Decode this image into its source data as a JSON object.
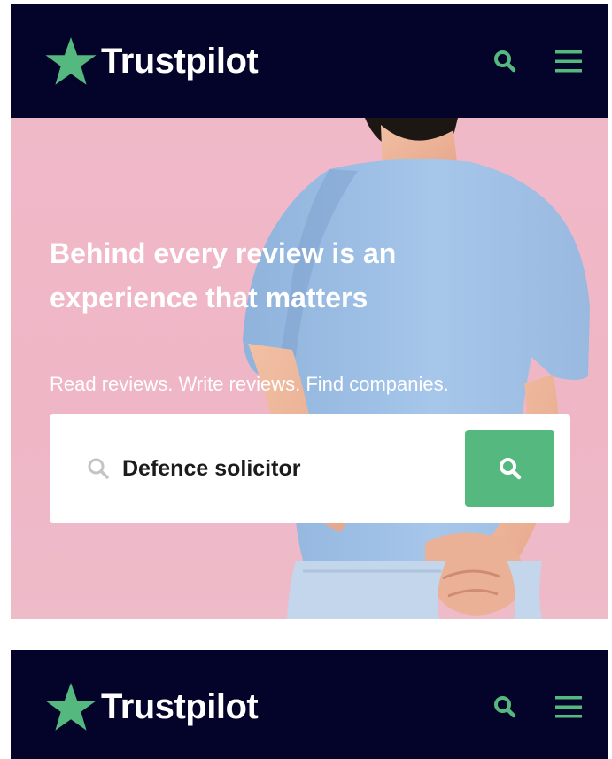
{
  "brand": {
    "name": "Trustpilot",
    "star_color": "#54b87f",
    "header_bg": "#04032a"
  },
  "header": {
    "search_icon": "search-icon",
    "menu_icon": "hamburger-menu-icon"
  },
  "hero": {
    "title": "Behind every review is an experience that matters",
    "subtitle": "Read reviews. Write reviews. Find companies.",
    "background": "#efb6c6"
  },
  "search": {
    "value": "Defence solicitor",
    "field_icon": "search-icon",
    "button_icon": "search-icon",
    "button_color": "#54b87f"
  }
}
